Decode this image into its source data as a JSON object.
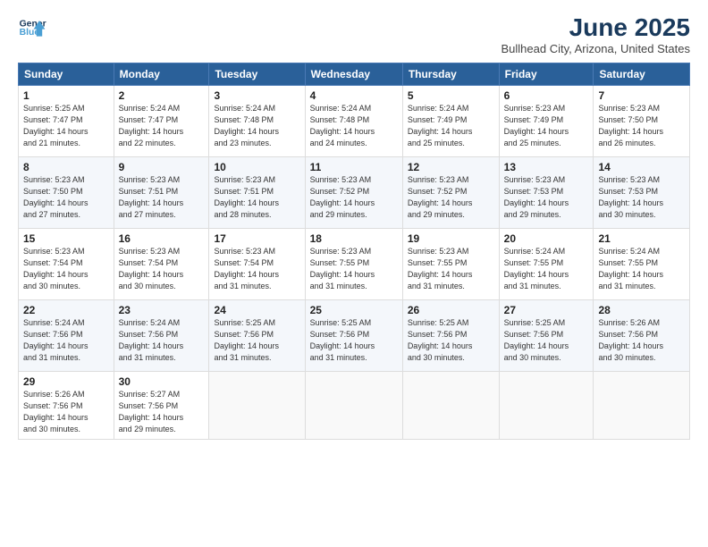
{
  "header": {
    "logo_line1": "General",
    "logo_line2": "Blue",
    "title": "June 2025",
    "subtitle": "Bullhead City, Arizona, United States"
  },
  "days_of_week": [
    "Sunday",
    "Monday",
    "Tuesday",
    "Wednesday",
    "Thursday",
    "Friday",
    "Saturday"
  ],
  "weeks": [
    [
      {
        "day": 1,
        "info": "Sunrise: 5:25 AM\nSunset: 7:47 PM\nDaylight: 14 hours\nand 21 minutes."
      },
      {
        "day": 2,
        "info": "Sunrise: 5:24 AM\nSunset: 7:47 PM\nDaylight: 14 hours\nand 22 minutes."
      },
      {
        "day": 3,
        "info": "Sunrise: 5:24 AM\nSunset: 7:48 PM\nDaylight: 14 hours\nand 23 minutes."
      },
      {
        "day": 4,
        "info": "Sunrise: 5:24 AM\nSunset: 7:48 PM\nDaylight: 14 hours\nand 24 minutes."
      },
      {
        "day": 5,
        "info": "Sunrise: 5:24 AM\nSunset: 7:49 PM\nDaylight: 14 hours\nand 25 minutes."
      },
      {
        "day": 6,
        "info": "Sunrise: 5:23 AM\nSunset: 7:49 PM\nDaylight: 14 hours\nand 25 minutes."
      },
      {
        "day": 7,
        "info": "Sunrise: 5:23 AM\nSunset: 7:50 PM\nDaylight: 14 hours\nand 26 minutes."
      }
    ],
    [
      {
        "day": 8,
        "info": "Sunrise: 5:23 AM\nSunset: 7:50 PM\nDaylight: 14 hours\nand 27 minutes."
      },
      {
        "day": 9,
        "info": "Sunrise: 5:23 AM\nSunset: 7:51 PM\nDaylight: 14 hours\nand 27 minutes."
      },
      {
        "day": 10,
        "info": "Sunrise: 5:23 AM\nSunset: 7:51 PM\nDaylight: 14 hours\nand 28 minutes."
      },
      {
        "day": 11,
        "info": "Sunrise: 5:23 AM\nSunset: 7:52 PM\nDaylight: 14 hours\nand 29 minutes."
      },
      {
        "day": 12,
        "info": "Sunrise: 5:23 AM\nSunset: 7:52 PM\nDaylight: 14 hours\nand 29 minutes."
      },
      {
        "day": 13,
        "info": "Sunrise: 5:23 AM\nSunset: 7:53 PM\nDaylight: 14 hours\nand 29 minutes."
      },
      {
        "day": 14,
        "info": "Sunrise: 5:23 AM\nSunset: 7:53 PM\nDaylight: 14 hours\nand 30 minutes."
      }
    ],
    [
      {
        "day": 15,
        "info": "Sunrise: 5:23 AM\nSunset: 7:54 PM\nDaylight: 14 hours\nand 30 minutes."
      },
      {
        "day": 16,
        "info": "Sunrise: 5:23 AM\nSunset: 7:54 PM\nDaylight: 14 hours\nand 30 minutes."
      },
      {
        "day": 17,
        "info": "Sunrise: 5:23 AM\nSunset: 7:54 PM\nDaylight: 14 hours\nand 31 minutes."
      },
      {
        "day": 18,
        "info": "Sunrise: 5:23 AM\nSunset: 7:55 PM\nDaylight: 14 hours\nand 31 minutes."
      },
      {
        "day": 19,
        "info": "Sunrise: 5:23 AM\nSunset: 7:55 PM\nDaylight: 14 hours\nand 31 minutes."
      },
      {
        "day": 20,
        "info": "Sunrise: 5:24 AM\nSunset: 7:55 PM\nDaylight: 14 hours\nand 31 minutes."
      },
      {
        "day": 21,
        "info": "Sunrise: 5:24 AM\nSunset: 7:55 PM\nDaylight: 14 hours\nand 31 minutes."
      }
    ],
    [
      {
        "day": 22,
        "info": "Sunrise: 5:24 AM\nSunset: 7:56 PM\nDaylight: 14 hours\nand 31 minutes."
      },
      {
        "day": 23,
        "info": "Sunrise: 5:24 AM\nSunset: 7:56 PM\nDaylight: 14 hours\nand 31 minutes."
      },
      {
        "day": 24,
        "info": "Sunrise: 5:25 AM\nSunset: 7:56 PM\nDaylight: 14 hours\nand 31 minutes."
      },
      {
        "day": 25,
        "info": "Sunrise: 5:25 AM\nSunset: 7:56 PM\nDaylight: 14 hours\nand 31 minutes."
      },
      {
        "day": 26,
        "info": "Sunrise: 5:25 AM\nSunset: 7:56 PM\nDaylight: 14 hours\nand 30 minutes."
      },
      {
        "day": 27,
        "info": "Sunrise: 5:25 AM\nSunset: 7:56 PM\nDaylight: 14 hours\nand 30 minutes."
      },
      {
        "day": 28,
        "info": "Sunrise: 5:26 AM\nSunset: 7:56 PM\nDaylight: 14 hours\nand 30 minutes."
      }
    ],
    [
      {
        "day": 29,
        "info": "Sunrise: 5:26 AM\nSunset: 7:56 PM\nDaylight: 14 hours\nand 30 minutes."
      },
      {
        "day": 30,
        "info": "Sunrise: 5:27 AM\nSunset: 7:56 PM\nDaylight: 14 hours\nand 29 minutes."
      },
      null,
      null,
      null,
      null,
      null
    ]
  ]
}
